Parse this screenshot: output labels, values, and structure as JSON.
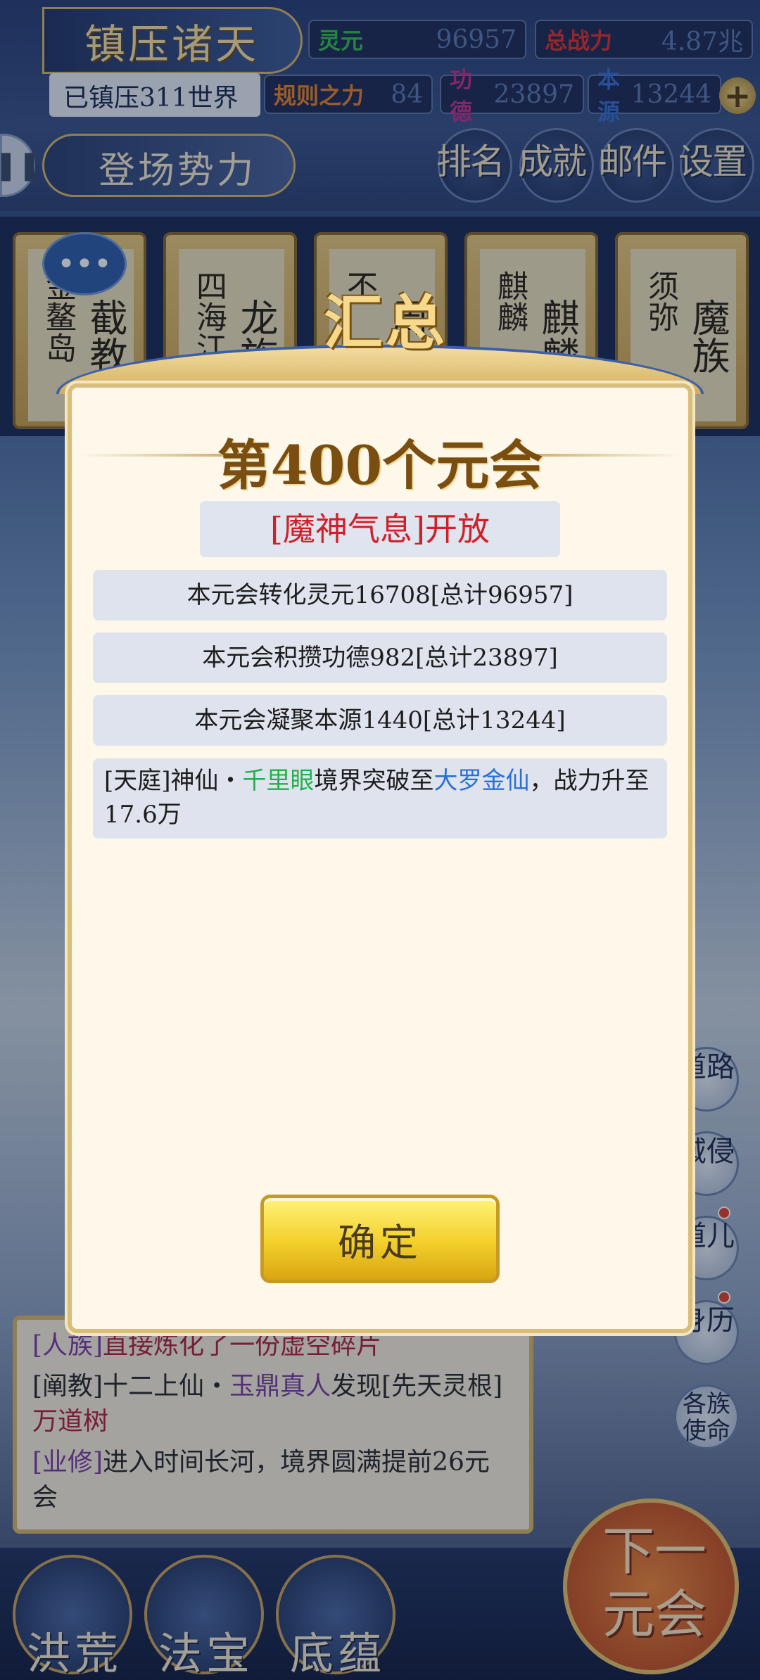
{
  "header": {
    "game_title": "镇压诸天",
    "subtitle": "已镇压311世界",
    "faction_button": "登场势力",
    "plus": "+",
    "resources": [
      {
        "name": "灵元",
        "value": "96957",
        "color": "#35c24a"
      },
      {
        "name": "总战力",
        "value": "4.87兆",
        "color": "#e0322a"
      },
      {
        "name": "规则之力",
        "value": "84",
        "color": "#e8832a"
      },
      {
        "name": "功德",
        "value": "23897",
        "color": "#c4338a"
      },
      {
        "name": "本源",
        "value": "13244",
        "color": "#3a6fd0"
      }
    ],
    "menu": [
      "排名",
      "成就",
      "邮件",
      "设置"
    ]
  },
  "tabs": [
    {
      "small": "金鳌岛",
      "big": "截教"
    },
    {
      "small": "四海江",
      "big": "龙族"
    },
    {
      "small": "不",
      "big": "周"
    },
    {
      "small": "麒麟",
      "big": "麒麟"
    },
    {
      "small": "须弥",
      "big": "魔族"
    }
  ],
  "chat_bubble": "•••",
  "side_buttons": [
    "道路",
    "域侵",
    "道儿",
    "身历",
    "各族使命"
  ],
  "log": {
    "line1": {
      "tag": "[人族]",
      "text": "直接炼化了一份虚空碎片"
    },
    "line2": {
      "pre": "[阐教]十二上仙・",
      "name": "玉鼎真人",
      "mid": "发现[先天灵根]",
      "item": "万道树"
    },
    "line3": {
      "tag": "[业修]",
      "text": "进入时间长河，境界圆满提前26元会"
    }
  },
  "bottom_nav": [
    "洪荒",
    "法宝",
    "底蕴"
  ],
  "next_era": "下一元会",
  "modal": {
    "title": "汇总",
    "era": "第400个元会",
    "open_notice": "[魔神气息]开放",
    "rows": [
      "本元会转化灵元16708[总计96957]",
      "本元会积攒功德982[总计23897]",
      "本元会凝聚本源1440[总计13244]"
    ],
    "news": {
      "pre": "[天庭]神仙・",
      "name": "千里眼",
      "mid": "境界突破至",
      "realm": "大罗金仙",
      "post": "，战力升至17.6万"
    },
    "confirm": "确定"
  },
  "colors": {
    "green": "#22b04a",
    "blue": "#2a6fd6",
    "red": "#d0202a",
    "gold": "#d9bd7a"
  }
}
